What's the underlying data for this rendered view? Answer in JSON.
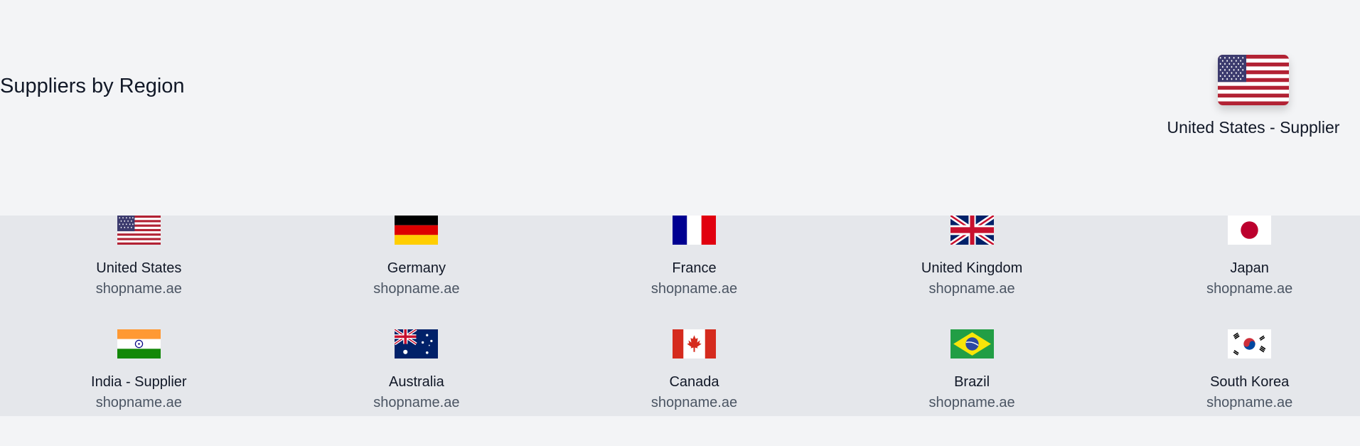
{
  "page": {
    "title": "Suppliers by Region"
  },
  "selected": {
    "label": "United States - Supplier",
    "flag_icon": "us-flag-icon"
  },
  "suppliers": [
    {
      "name": "United States",
      "domain": "shopname.ae",
      "flag_icon": "us-flag-icon"
    },
    {
      "name": "Germany",
      "domain": "shopname.ae",
      "flag_icon": "de-flag-icon"
    },
    {
      "name": "France",
      "domain": "shopname.ae",
      "flag_icon": "fr-flag-icon"
    },
    {
      "name": "United Kingdom",
      "domain": "shopname.ae",
      "flag_icon": "gb-flag-icon"
    },
    {
      "name": "Japan",
      "domain": "shopname.ae",
      "flag_icon": "jp-flag-icon"
    },
    {
      "name": "India - Supplier",
      "domain": "shopname.ae",
      "flag_icon": "in-flag-icon"
    },
    {
      "name": "Australia",
      "domain": "shopname.ae",
      "flag_icon": "au-flag-icon"
    },
    {
      "name": "Canada",
      "domain": "shopname.ae",
      "flag_icon": "ca-flag-icon"
    },
    {
      "name": "Brazil",
      "domain": "shopname.ae",
      "flag_icon": "br-flag-icon"
    },
    {
      "name": "South Korea",
      "domain": "shopname.ae",
      "flag_icon": "kr-flag-icon"
    }
  ],
  "colors": {
    "page_bg": "#f3f4f6",
    "band_bg": "#e5e7eb",
    "text": "#111827",
    "muted_text": "#4b5563"
  }
}
